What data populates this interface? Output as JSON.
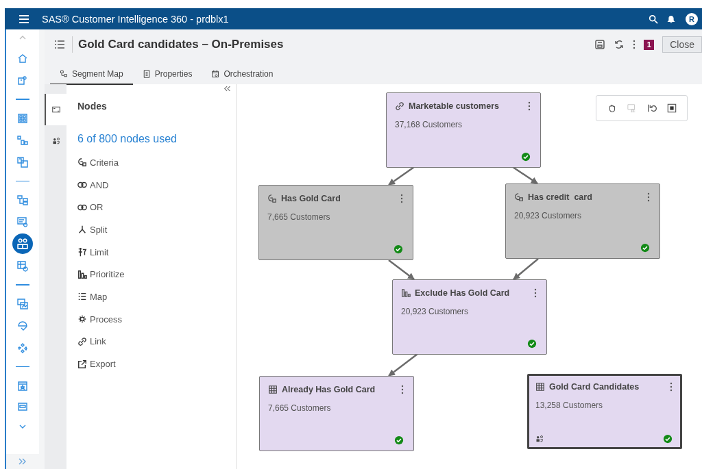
{
  "app_title": "SAS® Customer Intelligence 360 - prdblx1",
  "user_initial": "R",
  "rail_items": [
    {
      "selected": false
    },
    {
      "selected": false
    },
    {
      "selected": false
    },
    {
      "selected": false
    },
    {
      "selected": false
    },
    {
      "selected": false
    },
    {
      "selected": false
    },
    {
      "selected": true
    },
    {
      "selected": false
    },
    {
      "selected": false
    },
    {
      "selected": false
    },
    {
      "selected": false
    },
    {
      "selected": false
    },
    {
      "selected": false
    }
  ],
  "header": {
    "title": "Gold Card candidates – On-Premises",
    "badge": "1",
    "close": "Close"
  },
  "tabs": [
    {
      "label": "Segment Map",
      "selected": true
    },
    {
      "label": "Properties",
      "selected": false
    },
    {
      "label": "Orchestration",
      "selected": false
    }
  ],
  "panel_tabs": [
    {
      "selected": true
    },
    {
      "selected": false
    }
  ],
  "panel": {
    "title": "Nodes",
    "usage": "6 of 800 nodes used",
    "items": [
      {
        "label": "Criteria",
        "kind": "criteria"
      },
      {
        "label": "AND",
        "kind": "and"
      },
      {
        "label": "OR",
        "kind": "or"
      },
      {
        "label": "Split",
        "kind": "split"
      },
      {
        "label": "Limit",
        "kind": "limit"
      },
      {
        "label": "Prioritize",
        "kind": "prioritize"
      },
      {
        "label": "Map",
        "kind": "map"
      },
      {
        "label": "Process",
        "kind": "process"
      },
      {
        "label": "Link",
        "kind": "link"
      },
      {
        "label": "Export",
        "kind": "export"
      }
    ]
  },
  "nodes": [
    {
      "title": "Marketable customers",
      "count": "37,168 Customers",
      "kind": "link",
      "color": "#e3d9f0",
      "selected": false,
      "audience": false
    },
    {
      "title": "Has Gold Card",
      "count": "7,665 Customers",
      "kind": "criteria",
      "color": "#c4c4c4",
      "selected": false,
      "audience": false
    },
    {
      "title": "Has credit  card",
      "count": "20,923 Customers",
      "kind": "criteria",
      "color": "#c4c4c4",
      "selected": false,
      "audience": false
    },
    {
      "title": "Exclude Has Gold Card",
      "count": "20,923 Customers",
      "kind": "prioritize",
      "color": "#e3d9f0",
      "selected": false,
      "audience": false
    },
    {
      "title": "Already Has Gold Card",
      "count": "7,665 Customers",
      "kind": "table",
      "color": "#e3d9f0",
      "selected": false,
      "audience": false
    },
    {
      "title": "Gold Card Candidates",
      "count": "13,258 Customers",
      "kind": "table",
      "color": "#e3d9f0",
      "selected": true,
      "audience": true
    }
  ]
}
